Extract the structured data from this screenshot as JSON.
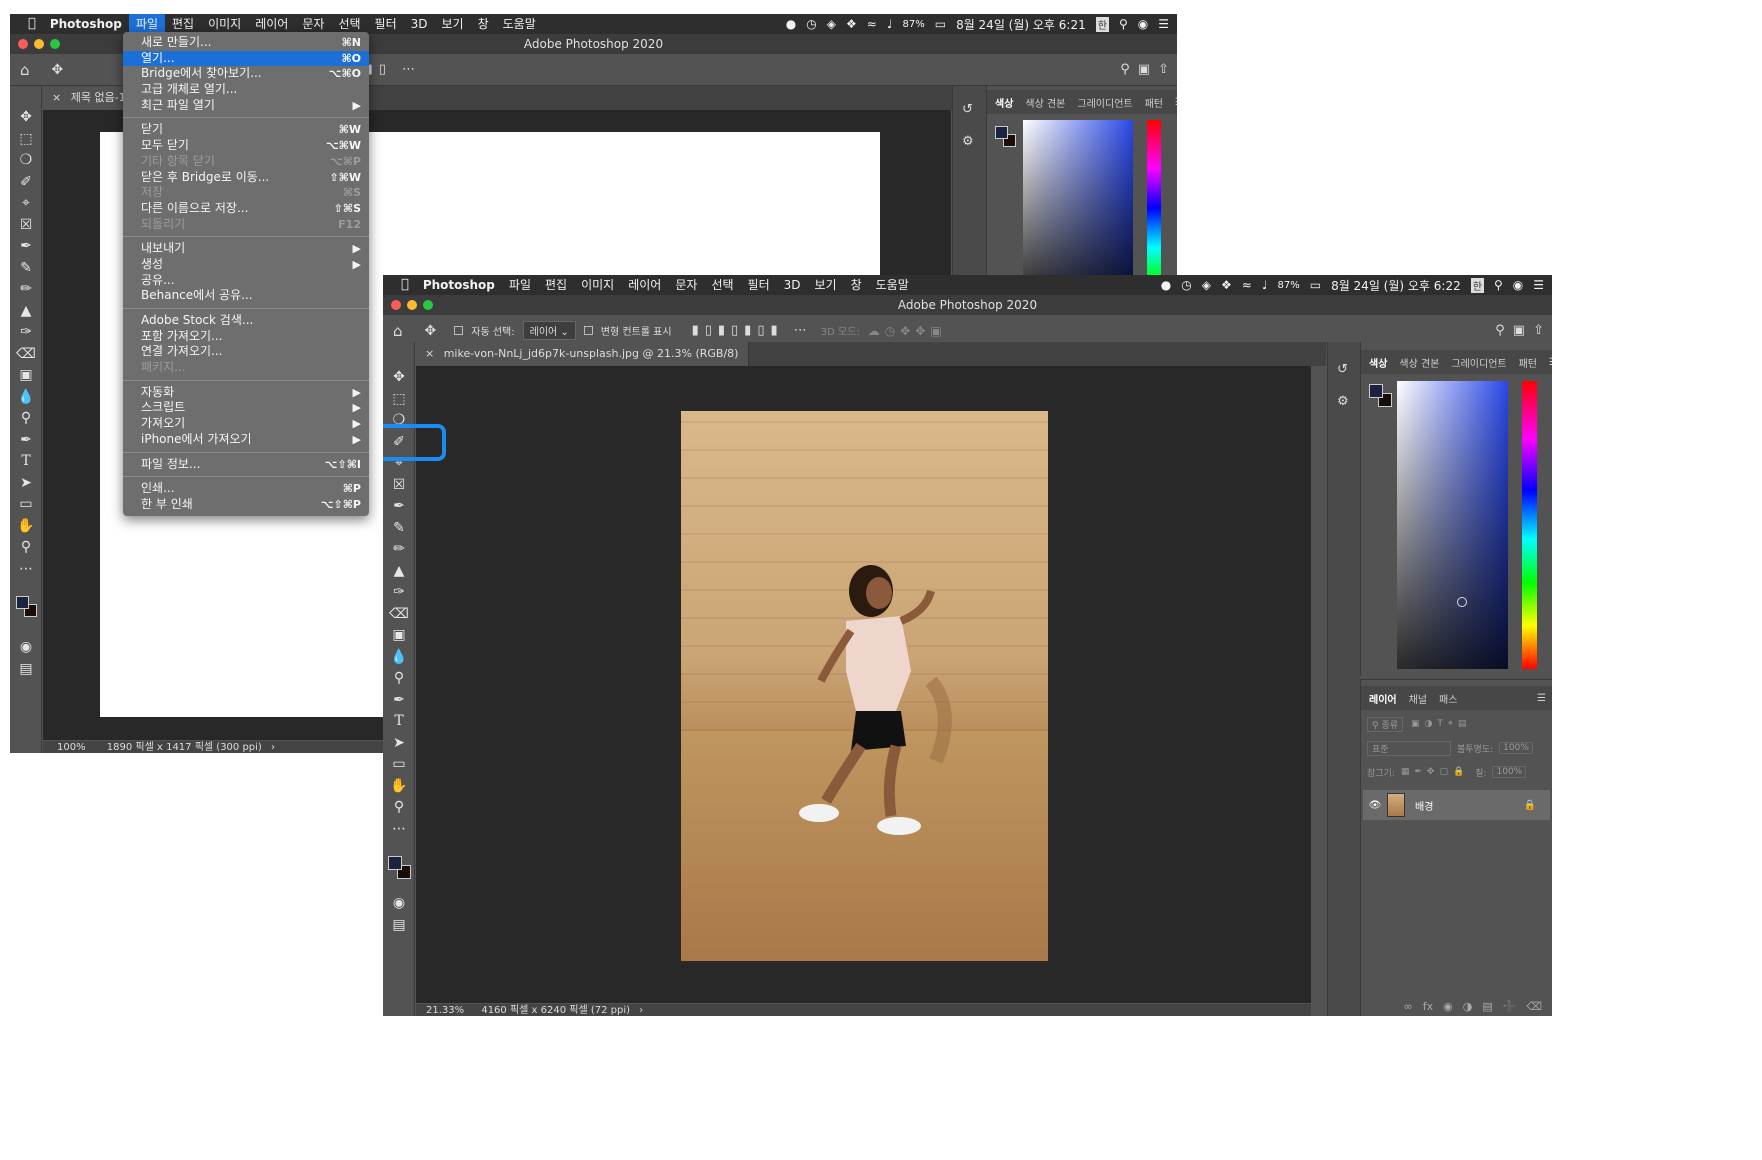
{
  "back": {
    "menubar": {
      "app": "Photoshop",
      "items": [
        "파일",
        "편집",
        "이미지",
        "레이어",
        "문자",
        "선택",
        "필터",
        "3D",
        "보기",
        "창",
        "도움말"
      ],
      "battery": "87%",
      "datetime": "8월 24일 (월) 오후 6:21"
    },
    "title": "Adobe Photoshop 2020",
    "doc_tab": "제목 없음-1 @",
    "panel_tabs": [
      "색상",
      "색상 견본",
      "그레이디언트",
      "패턴"
    ],
    "status_zoom": "100%",
    "status_info": "1890 픽셀 x 1417 픽셀 (300 ppi)"
  },
  "file_menu": {
    "groups": [
      [
        {
          "label": "새로 만들기...",
          "shortcut": "⌘N"
        },
        {
          "label": "열기...",
          "shortcut": "⌘O",
          "highlighted": true
        },
        {
          "label": "Bridge에서 찾아보기...",
          "shortcut": "⌥⌘O"
        },
        {
          "label": "고급 개체로 열기...",
          "shortcut": ""
        },
        {
          "label": "최근 파일 열기",
          "shortcut": "▶"
        }
      ],
      [
        {
          "label": "닫기",
          "shortcut": "⌘W"
        },
        {
          "label": "모두 닫기",
          "shortcut": "⌥⌘W"
        },
        {
          "label": "기타 항목 닫기",
          "shortcut": "⌥⌘P",
          "disabled": true
        },
        {
          "label": "닫은 후 Bridge로 이동...",
          "shortcut": "⇧⌘W"
        },
        {
          "label": "저장",
          "shortcut": "⌘S",
          "disabled": true
        },
        {
          "label": "다른 이름으로 저장...",
          "shortcut": "⇧⌘S"
        },
        {
          "label": "되돌리기",
          "shortcut": "F12",
          "disabled": true
        }
      ],
      [
        {
          "label": "내보내기",
          "shortcut": "▶"
        },
        {
          "label": "생성",
          "shortcut": "▶"
        },
        {
          "label": "공유...",
          "shortcut": ""
        },
        {
          "label": "Behance에서 공유...",
          "shortcut": ""
        }
      ],
      [
        {
          "label": "Adobe Stock 검색...",
          "shortcut": ""
        },
        {
          "label": "포함 가져오기...",
          "shortcut": ""
        },
        {
          "label": "연결 가져오기...",
          "shortcut": ""
        },
        {
          "label": "패키지...",
          "shortcut": "",
          "disabled": true
        }
      ],
      [
        {
          "label": "자동화",
          "shortcut": "▶"
        },
        {
          "label": "스크립트",
          "shortcut": "▶"
        },
        {
          "label": "가져오기",
          "shortcut": "▶"
        },
        {
          "label": "iPhone에서 가져오기",
          "shortcut": "▶"
        }
      ],
      [
        {
          "label": "파일 정보...",
          "shortcut": "⌥⇧⌘I"
        }
      ],
      [
        {
          "label": "인쇄...",
          "shortcut": "⌘P"
        },
        {
          "label": "한 부 인쇄",
          "shortcut": "⌥⇧⌘P"
        }
      ]
    ]
  },
  "front": {
    "menubar": {
      "app": "Photoshop",
      "items": [
        "파일",
        "편집",
        "이미지",
        "레이어",
        "문자",
        "선택",
        "필터",
        "3D",
        "보기",
        "창",
        "도움말"
      ],
      "battery": "87%",
      "datetime": "8월 24일 (월) 오후 6:22"
    },
    "title": "Adobe Photoshop 2020",
    "options": {
      "auto_select": "자동 선택:",
      "layer_select": "레이어",
      "transform": "변형 컨트롤 표시",
      "mode3d": "3D 모드:"
    },
    "doc_tab": "mike-von-NnLj_jd6p7k-unsplash.jpg @ 21.3% (RGB/8)",
    "panel_tabs": [
      "색상",
      "색상 견본",
      "그레이디언트",
      "패턴"
    ],
    "layer_tabs": [
      "레이어",
      "채널",
      "패스"
    ],
    "layers": {
      "kind": "종류",
      "blend": "표준",
      "opacity_label": "불투명도:",
      "opacity": "100%",
      "lock_label": "잠그기:",
      "fill_label": "칠:",
      "fill": "100%",
      "layer_name": "배경"
    },
    "status_zoom": "21.33%",
    "status_info": "4160 픽셀 x 6240 픽셀 (72 ppi)"
  },
  "colors": {
    "accent": "#1d6fd8",
    "highlight_border": "#1a8cf0",
    "foreground_swatch": "#1c2340",
    "background_swatch": "#1a0f08"
  }
}
